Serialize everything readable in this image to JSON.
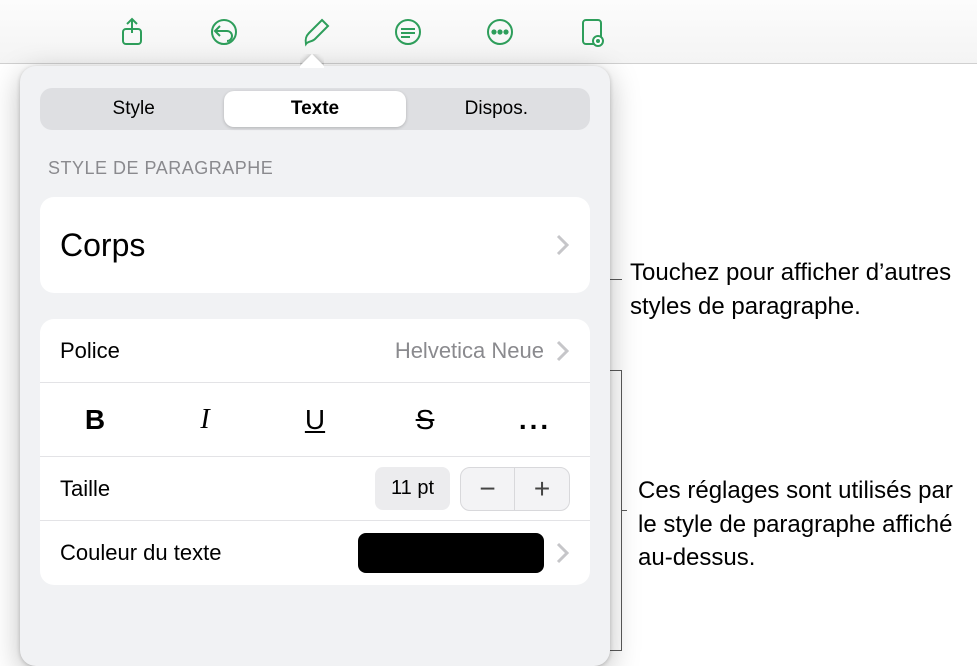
{
  "toolbar": {
    "icons": [
      "share",
      "undo",
      "format-brush",
      "comment",
      "more",
      "view-options"
    ]
  },
  "popover": {
    "tabs": {
      "style": "Style",
      "text": "Texte",
      "layout": "Dispos."
    },
    "section_label": "STYLE DE PARAGRAPHE",
    "paragraph_style": "Corps",
    "font_row": {
      "label": "Police",
      "value": "Helvetica Neue"
    },
    "format_buttons": {
      "bold": "B",
      "italic": "I",
      "underline": "U",
      "strike": "S",
      "more": "..."
    },
    "size_row": {
      "label": "Taille",
      "value": "11 pt"
    },
    "color_row": {
      "label": "Couleur du texte",
      "swatch": "#000000"
    }
  },
  "callouts": {
    "a": "Touchez pour afficher d’autres styles de paragraphe.",
    "b": "Ces réglages sont utilisés par le style de paragraphe affiché au-dessus."
  }
}
